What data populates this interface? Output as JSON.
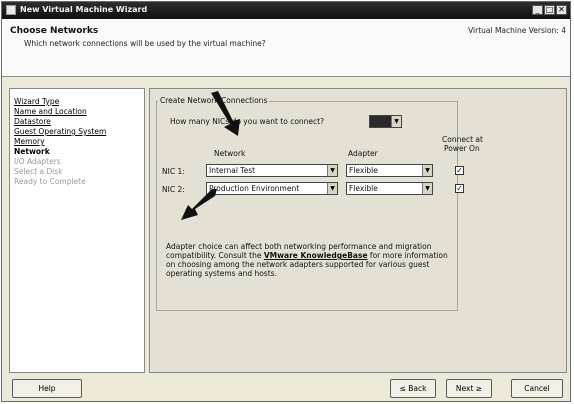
{
  "window": {
    "title": "New Virtual Machine Wizard",
    "controls": [
      "_",
      "□",
      "✕"
    ]
  },
  "header": {
    "title": "Choose Networks",
    "subtitle": "Which network connections will be used by the virtual machine?",
    "version": "Virtual Machine Version: 4"
  },
  "nav": {
    "items": [
      {
        "label": "Wizard Type",
        "state": "done"
      },
      {
        "label": "Name and Location",
        "state": "done"
      },
      {
        "label": "Datastore",
        "state": "done"
      },
      {
        "label": "Guest Operating System",
        "state": "done"
      },
      {
        "label": "Memory",
        "state": "done"
      },
      {
        "label": "Network",
        "state": "current"
      },
      {
        "label": "I/O Adapters",
        "state": "future"
      },
      {
        "label": "Select a Disk",
        "state": "future"
      },
      {
        "label": "Ready to Complete",
        "state": "future"
      }
    ]
  },
  "network": {
    "group_label": "Create Network Connections",
    "nic_question": "How many NICs do you want to connect?",
    "nic_count": "",
    "col_network": "Network",
    "col_adapter": "Adapter",
    "col_connect_line1": "Connect at",
    "col_connect_line2": "Power On",
    "nics": [
      {
        "label": "NIC 1:",
        "network": "Internal Test",
        "adapter": "Flexible",
        "connect_checked": true
      },
      {
        "label": "NIC 2:",
        "network": "Production Environment",
        "adapter": "Flexible",
        "connect_checked": true
      }
    ],
    "check_mark": "✓",
    "info_before": "Adapter choice can affect both networking performance and migration compatibility. Consult the ",
    "info_link": "VMware KnowledgeBase",
    "info_after": " for more information on choosing among the network adapters supported for various guest operating systems and hosts."
  },
  "buttons": {
    "help": "Help",
    "back": "≤ Back",
    "next": "Next ≥",
    "cancel": "Cancel"
  },
  "icons": {
    "dropdown": "▼",
    "annotation_arrow": "arrow-annotation"
  }
}
